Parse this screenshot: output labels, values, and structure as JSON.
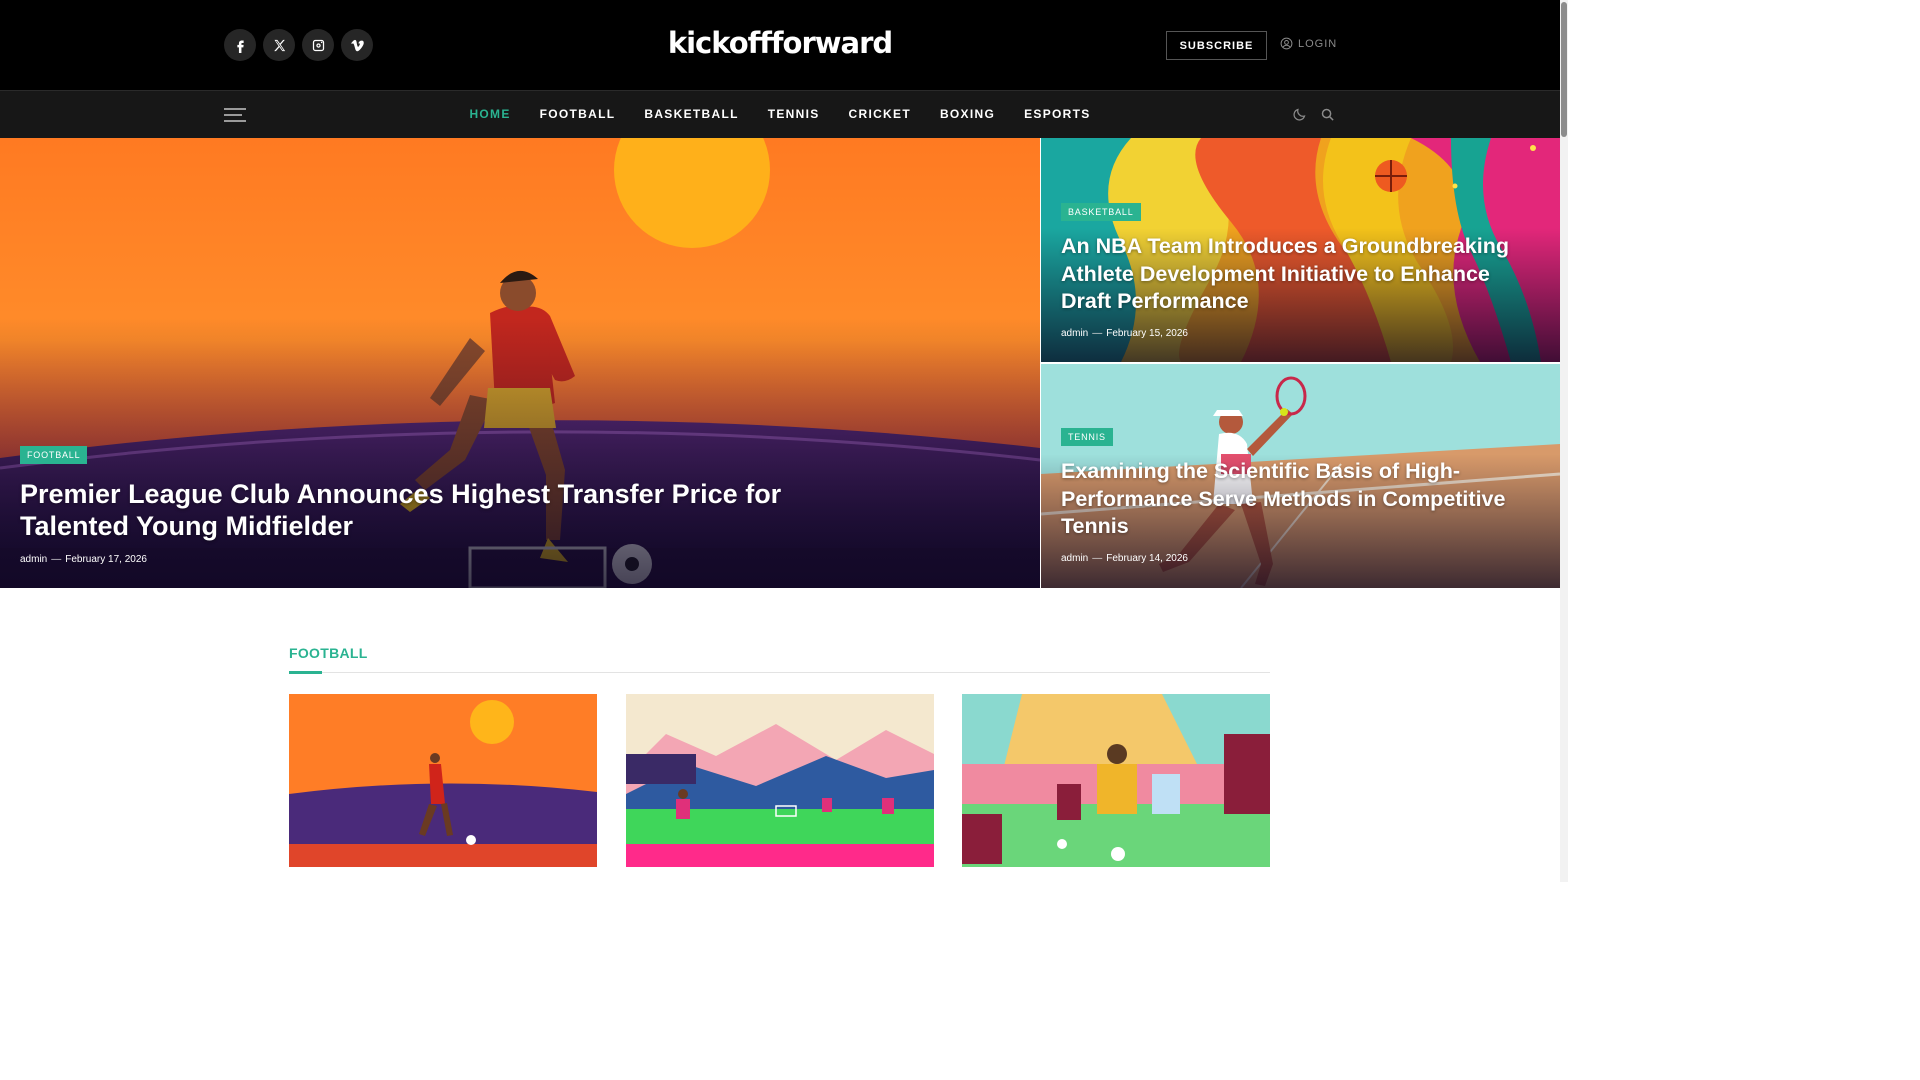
{
  "site": {
    "logo": "kickoffforward"
  },
  "header": {
    "social": [
      {
        "icon": "facebook-icon"
      },
      {
        "icon": "x-icon"
      },
      {
        "icon": "instagram-icon"
      },
      {
        "icon": "vimeo-icon"
      }
    ],
    "subscribe_label": "SUBSCRIBE",
    "login_label": "LOGIN"
  },
  "nav": {
    "items": [
      "HOME",
      "FOOTBALL",
      "BASKETBALL",
      "TENNIS",
      "CRICKET",
      "BOXING",
      "ESPORTS"
    ],
    "active": "HOME",
    "icons": [
      "dark-mode-icon",
      "search-icon"
    ]
  },
  "hero": {
    "main": {
      "category": "FOOTBALL",
      "title": "Premier League Club Announces Highest Transfer Price for Talented Young Midfielder",
      "author": "admin",
      "separator": "—",
      "date": "February 17, 2026"
    },
    "side": [
      {
        "category": "BASKETBALL",
        "title": "An NBA Team Introduces a Groundbreaking Athlete Development Initiative to Enhance Draft Performance",
        "author": "admin",
        "separator": "—",
        "date": "February 15, 2026"
      },
      {
        "category": "TENNIS",
        "title": "Examining the Scientific Basis of High-Performance Serve Methods in Competitive Tennis",
        "author": "admin",
        "separator": "—",
        "date": "February 14, 2026"
      }
    ]
  },
  "section": {
    "title": "FOOTBALL"
  },
  "colors": {
    "accent": "#2ab391",
    "header_bg": "#000000",
    "nav_bg": "#171717"
  }
}
